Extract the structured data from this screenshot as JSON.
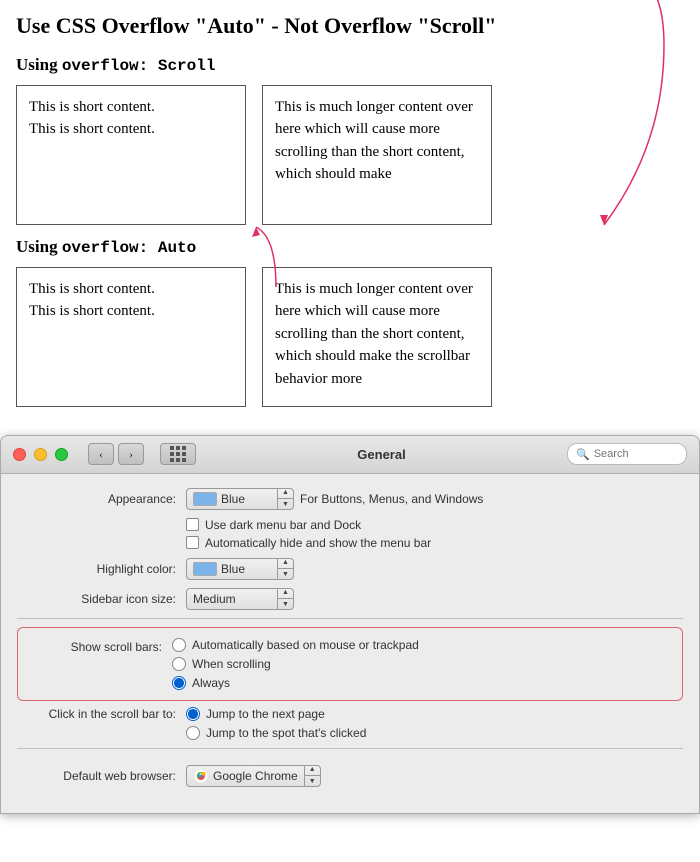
{
  "article": {
    "title": "Use CSS Overflow \"Auto\" - Not Overflow \"Scroll\"",
    "section1_heading": "Using ",
    "section1_code": "overflow: Scroll",
    "section2_heading": "Using ",
    "section2_code": "overflow: Auto",
    "short_content_line1": "This is short content.",
    "short_content_line2": "This is short content.",
    "long_content": "This is much longer content over here which will cause more scrolling than the short content, which should make",
    "long_content_auto": "This is much longer content over here which will cause more scrolling than the short content, which should make the scrollbar behavior more"
  },
  "mac_window": {
    "title": "General",
    "search_placeholder": "Search",
    "traffic_lights": [
      "close",
      "minimize",
      "maximize"
    ]
  },
  "preferences": {
    "appearance_label": "Appearance:",
    "appearance_value": "Blue",
    "appearance_description": "For Buttons, Menus, and Windows",
    "dark_menu_label": "Use dark menu bar and Dock",
    "auto_hide_label": "Automatically hide and show the menu bar",
    "highlight_label": "Highlight color:",
    "highlight_value": "Blue",
    "sidebar_label": "Sidebar icon size:",
    "sidebar_value": "Medium",
    "scroll_bars_label": "Show scroll bars:",
    "scroll_option1": "Automatically based on mouse or trackpad",
    "scroll_option2": "When scrolling",
    "scroll_option3": "Always",
    "click_label": "Click in the scroll bar to:",
    "click_option1": "Jump to the next page",
    "click_option2": "Jump to the spot that's clicked",
    "browser_label": "Default web browser:",
    "browser_value": "Google Chrome"
  }
}
